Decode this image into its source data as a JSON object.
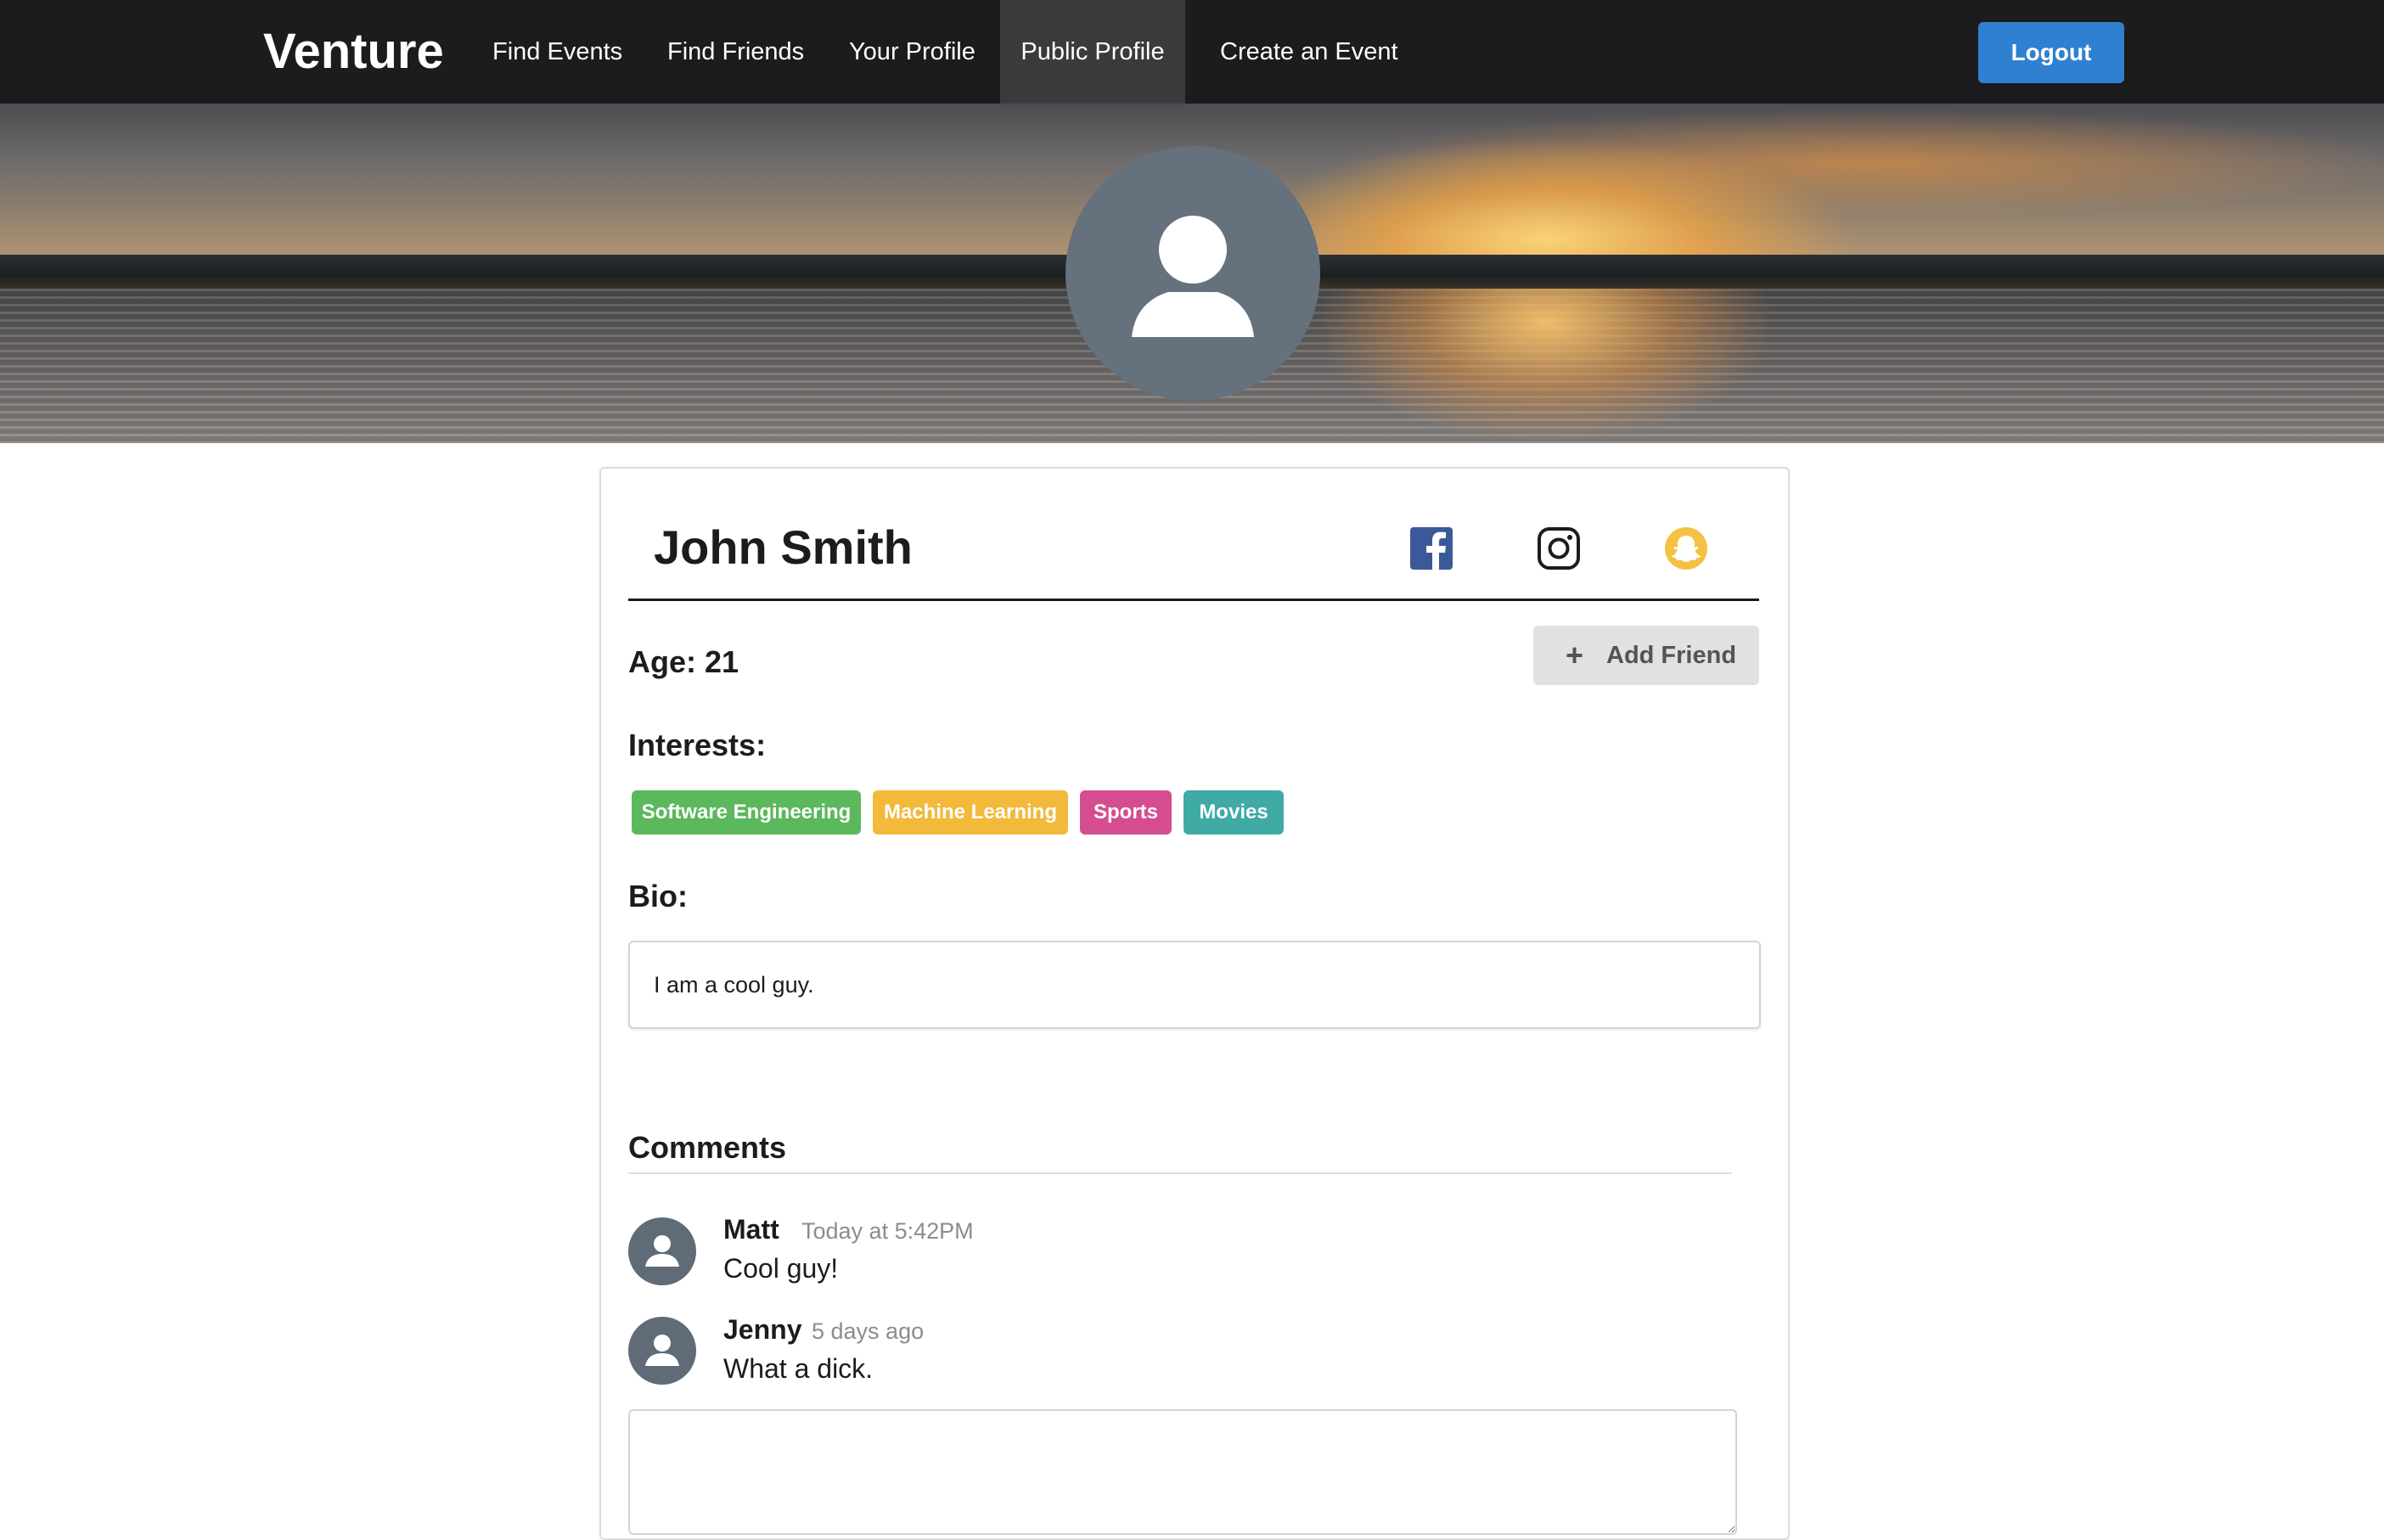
{
  "nav": {
    "brand": "Venture",
    "items": [
      {
        "label": "Find Events"
      },
      {
        "label": "Find Friends"
      },
      {
        "label": "Your Profile"
      },
      {
        "label": "Public Profile",
        "active": true
      },
      {
        "label": "Create an Event"
      }
    ],
    "logout_label": "Logout"
  },
  "profile": {
    "name": "John Smith",
    "social_icons": [
      "facebook-icon",
      "instagram-icon",
      "snapchat-icon"
    ],
    "age_label": "Age: 21",
    "add_friend_label": "Add Friend",
    "interests_label": "Interests:",
    "interests": [
      {
        "label": "Software Engineering",
        "color": "#5bb85c"
      },
      {
        "label": "Machine Learning",
        "color": "#f2b93b"
      },
      {
        "label": "Sports",
        "color": "#d64d8f"
      },
      {
        "label": "Movies",
        "color": "#40aaa5"
      }
    ],
    "bio_label": "Bio:",
    "bio_text": "I am a cool guy."
  },
  "comments": {
    "title": "Comments",
    "items": [
      {
        "author": "Matt",
        "date": "Today at 5:42PM",
        "text": "Cool guy!"
      },
      {
        "author": "Jenny",
        "date": "5 days ago",
        "text": "What a dick."
      }
    ],
    "reply_value": ""
  },
  "colors": {
    "navbar": "#1b1c1d",
    "primary_button": "#2f80d0",
    "facebook": "#3b5998",
    "snapchat": "#f5c144"
  }
}
